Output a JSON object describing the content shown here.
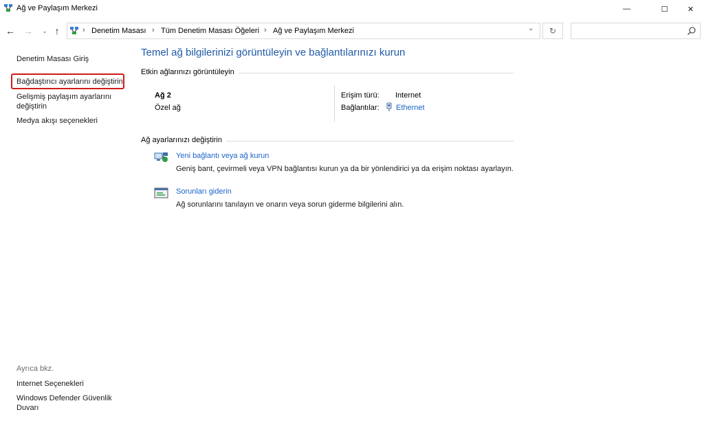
{
  "window": {
    "title": "Ağ ve Paylaşım Merkezi",
    "minimize_glyph": "—",
    "maximize_glyph": "☐",
    "close_glyph": "✕"
  },
  "nav": {
    "back_glyph": "←",
    "forward_glyph": "→",
    "recent_glyph": "⌄",
    "up_glyph": "↑",
    "breadcrumb": [
      "Denetim Masası",
      "Tüm Denetim Masası Öğeleri",
      "Ağ ve Paylaşım Merkezi"
    ],
    "breadcrumb_separator": "›",
    "dropdown_glyph": "⌄",
    "refresh_glyph": "↻",
    "search_placeholder": ""
  },
  "sidebar": {
    "items": [
      {
        "label": "Denetim Masası Giriş"
      },
      {
        "label": "Bağdaştırıcı ayarlarını değiştirin"
      },
      {
        "label": "Gelişmiş paylaşım ayarlarını değiştirin"
      },
      {
        "label": "Medya akışı seçenekleri"
      }
    ],
    "see_also_label": "Ayrıca bkz.",
    "see_also_items": [
      {
        "label": "Internet Seçenekleri"
      },
      {
        "label": "Windows Defender Güvenlik Duvarı"
      }
    ]
  },
  "main": {
    "title": "Temel ağ bilgilerinizi görüntüleyin ve bağlantılarınızı kurun",
    "active_networks_heading": "Etkin ağlarınızı görüntüleyin",
    "network": {
      "name": "Ağ 2",
      "type": "Özel ağ",
      "access_label": "Erişim türü:",
      "access_value": "Internet",
      "connections_label": "Bağlantılar:",
      "connection_name": "Ethernet"
    },
    "change_settings_heading": "Ağ ayarlarınızı değiştirin",
    "tasks": [
      {
        "icon": "network-setup-icon",
        "link": "Yeni bağlantı veya ağ kurun",
        "description": "Geniş bant, çevirmeli veya VPN bağlantısı kurun ya da bir yönlendirici ya da erişim noktası ayarlayın."
      },
      {
        "icon": "troubleshoot-icon",
        "link": "Sorunları giderin",
        "description": "Ağ sorunlarını tanılayın ve onarın veya sorun giderme bilgilerini alın."
      }
    ]
  },
  "colors": {
    "title_blue": "#1e5aa6",
    "link_blue": "#1a64c8",
    "highlight_red": "#d11919"
  }
}
